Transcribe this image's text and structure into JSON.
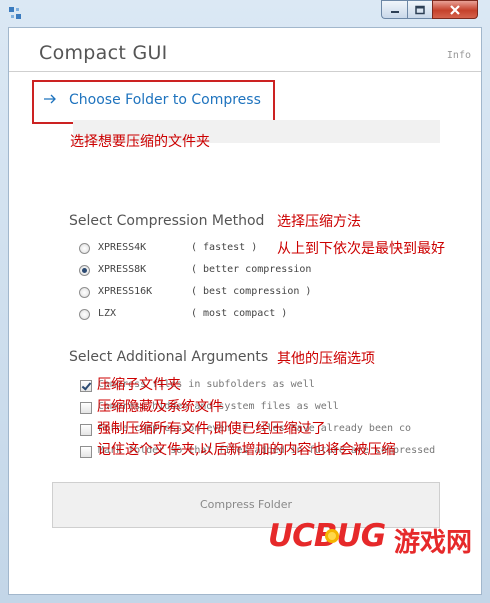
{
  "header": {
    "app_title": "Compact GUI",
    "info_link": "Info"
  },
  "folder": {
    "choose_label": "Choose Folder to Compress",
    "annotation": "选择想要压缩的文件夹"
  },
  "compression": {
    "title": "Select Compression Method",
    "annotation_1": "选择压缩方法",
    "annotation_2": "从上到下依次是最快到最好",
    "selected_index": 1,
    "options": [
      {
        "label": "XPRESS4K",
        "desc": "( fastest )"
      },
      {
        "label": "XPRESS8K",
        "desc": "( better compression"
      },
      {
        "label": "XPRESS16K",
        "desc": "( best compression )"
      },
      {
        "label": "LZX",
        "desc": "( most compact )"
      }
    ]
  },
  "arguments": {
    "title": "Select Additional Arguments",
    "annotation": "其他的压缩选项",
    "items": [
      {
        "label": "Compress files in subfolders as well",
        "checked": true,
        "annotation": "压缩子文件夹"
      },
      {
        "label": "Compress hidden and system files as well",
        "checked": false,
        "annotation": "压缩隐藏及系统文件"
      },
      {
        "label": "Force compression even if files have already been co",
        "checked": false,
        "annotation": "强制压缩所有文件,即使已经压缩过了"
      },
      {
        "label": "Mark folder so that files added in future are compressed",
        "checked": false,
        "annotation": "记住这个文件夹,以后新增加的内容也将会被压缩"
      }
    ]
  },
  "compress_button": {
    "label": "Compress Folder"
  },
  "watermark": {
    "brand": "UCBUG",
    "suffix": "游戏网",
    "brand_color": "#e6292a"
  },
  "colors": {
    "accent": "#1e73be",
    "annotation": "#cc0000",
    "highlight_border": "#cc2222"
  }
}
